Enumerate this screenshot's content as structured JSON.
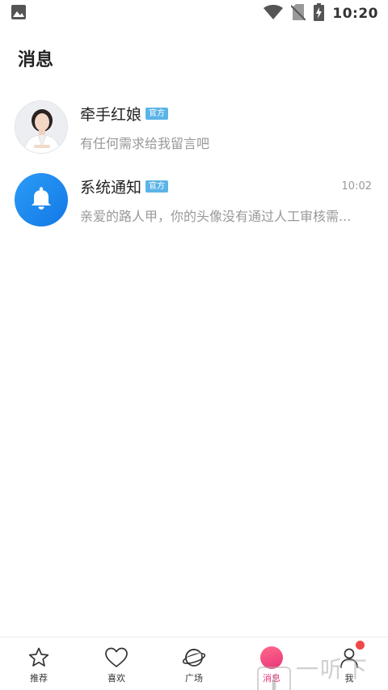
{
  "status_bar": {
    "time": "10:20",
    "icons": [
      "image-icon",
      "wifi-icon",
      "no-sim-icon",
      "battery-charging-icon"
    ]
  },
  "page": {
    "title": "消息"
  },
  "conversations": [
    {
      "name": "牵手红娘",
      "badge": "官方",
      "preview": "有任何需求给我留言吧",
      "time": "",
      "avatar": "matchmaker-photo"
    },
    {
      "name": "系统通知",
      "badge": "官方",
      "preview": "亲爱的路人甲，你的头像没有通过人工审核需...",
      "time": "10:02",
      "avatar": "bell-icon"
    }
  ],
  "bottom_nav": {
    "items": [
      {
        "label": "推荐",
        "icon": "star-icon"
      },
      {
        "label": "喜欢",
        "icon": "heart-icon"
      },
      {
        "label": "广场",
        "icon": "planet-icon"
      },
      {
        "label": "消息",
        "icon": "message-icon",
        "active": true
      },
      {
        "label": "我",
        "icon": "person-icon",
        "has_notification_dot": true
      }
    ],
    "active_color": "#e8337a"
  },
  "watermark": {
    "logo_glyph": "i",
    "text": "一听下载"
  }
}
